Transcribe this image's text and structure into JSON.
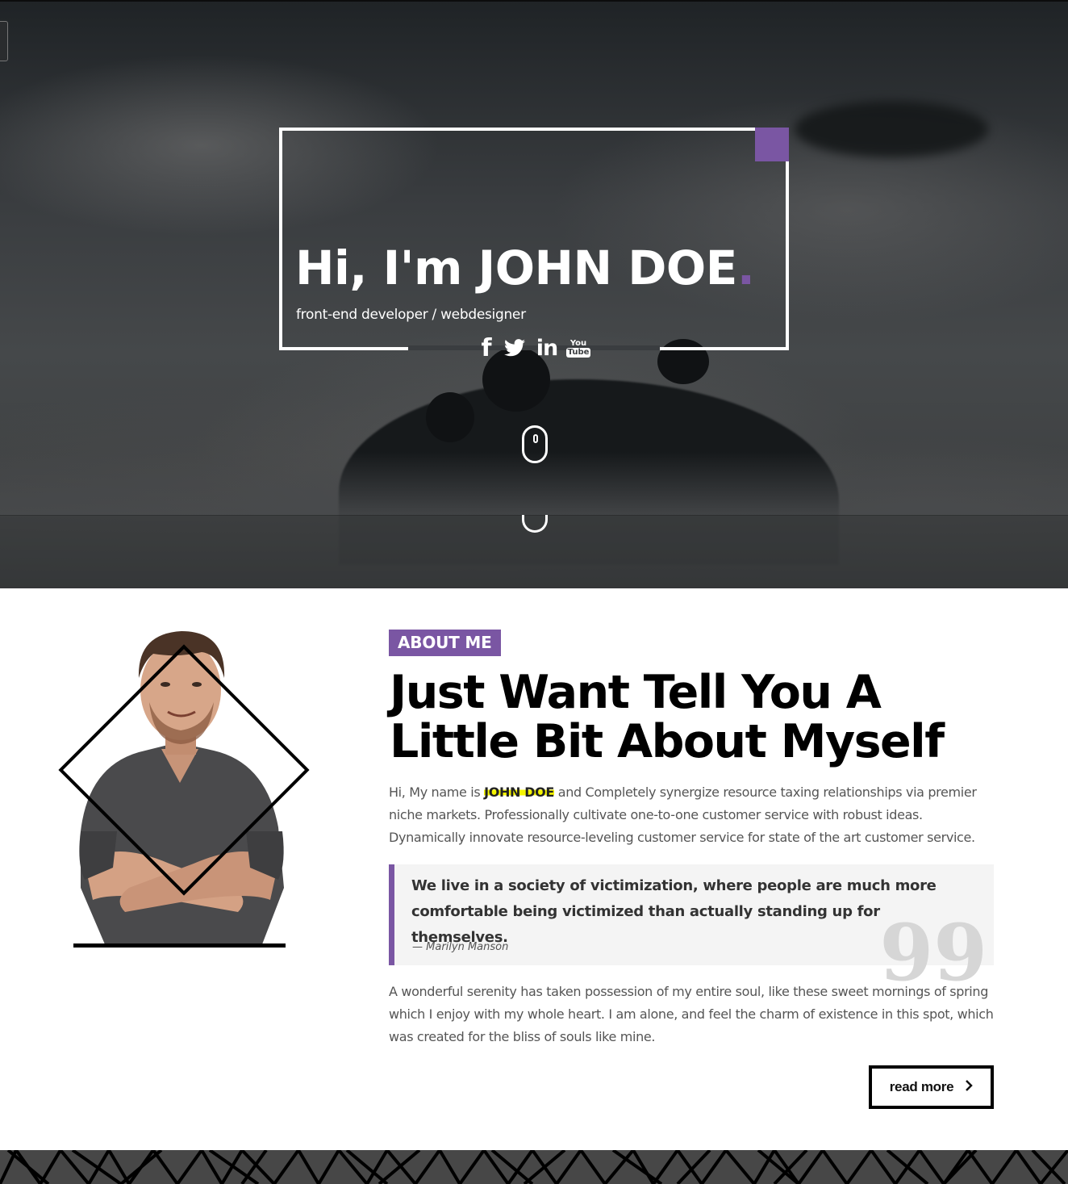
{
  "hero": {
    "greeting": "Hi, I'm",
    "name": "JOHN DOE",
    "dot": ".",
    "subtitle": "front-end developer / webdesigner",
    "social": {
      "facebook": "f",
      "linkedin": "in",
      "youtube_top": "You",
      "youtube_bottom": "Tube"
    },
    "accent_color": "#7a56a3"
  },
  "about": {
    "badge": "ABOUT ME",
    "heading_line1": "Just Want Tell You A",
    "heading_line2": "Little Bit About Myself",
    "intro_prefix": "Hi, My name is ",
    "intro_name": "JOHN DOE",
    "intro_rest": " and Completely synergize resource taxing relationships via premier niche markets. Professionally cultivate one-to-one customer service with robust ideas. Dynamically innovate resource-leveling customer service for state of the art customer service.",
    "quote": "We live in a society of victimization, where people are much more comfortable being victimized than actually standing up for themselves.",
    "quote_author": "— Marilyn Manson",
    "quote_mark": "99",
    "body": "A wonderful serenity has taken possession of my entire soul, like these sweet mornings of spring which I enjoy with my whole heart. I am alone, and feel the charm of existence in this spot, which was created for the bliss of souls like mine.",
    "read_more": "read more",
    "read_more_icon": "chevron-right-icon"
  }
}
